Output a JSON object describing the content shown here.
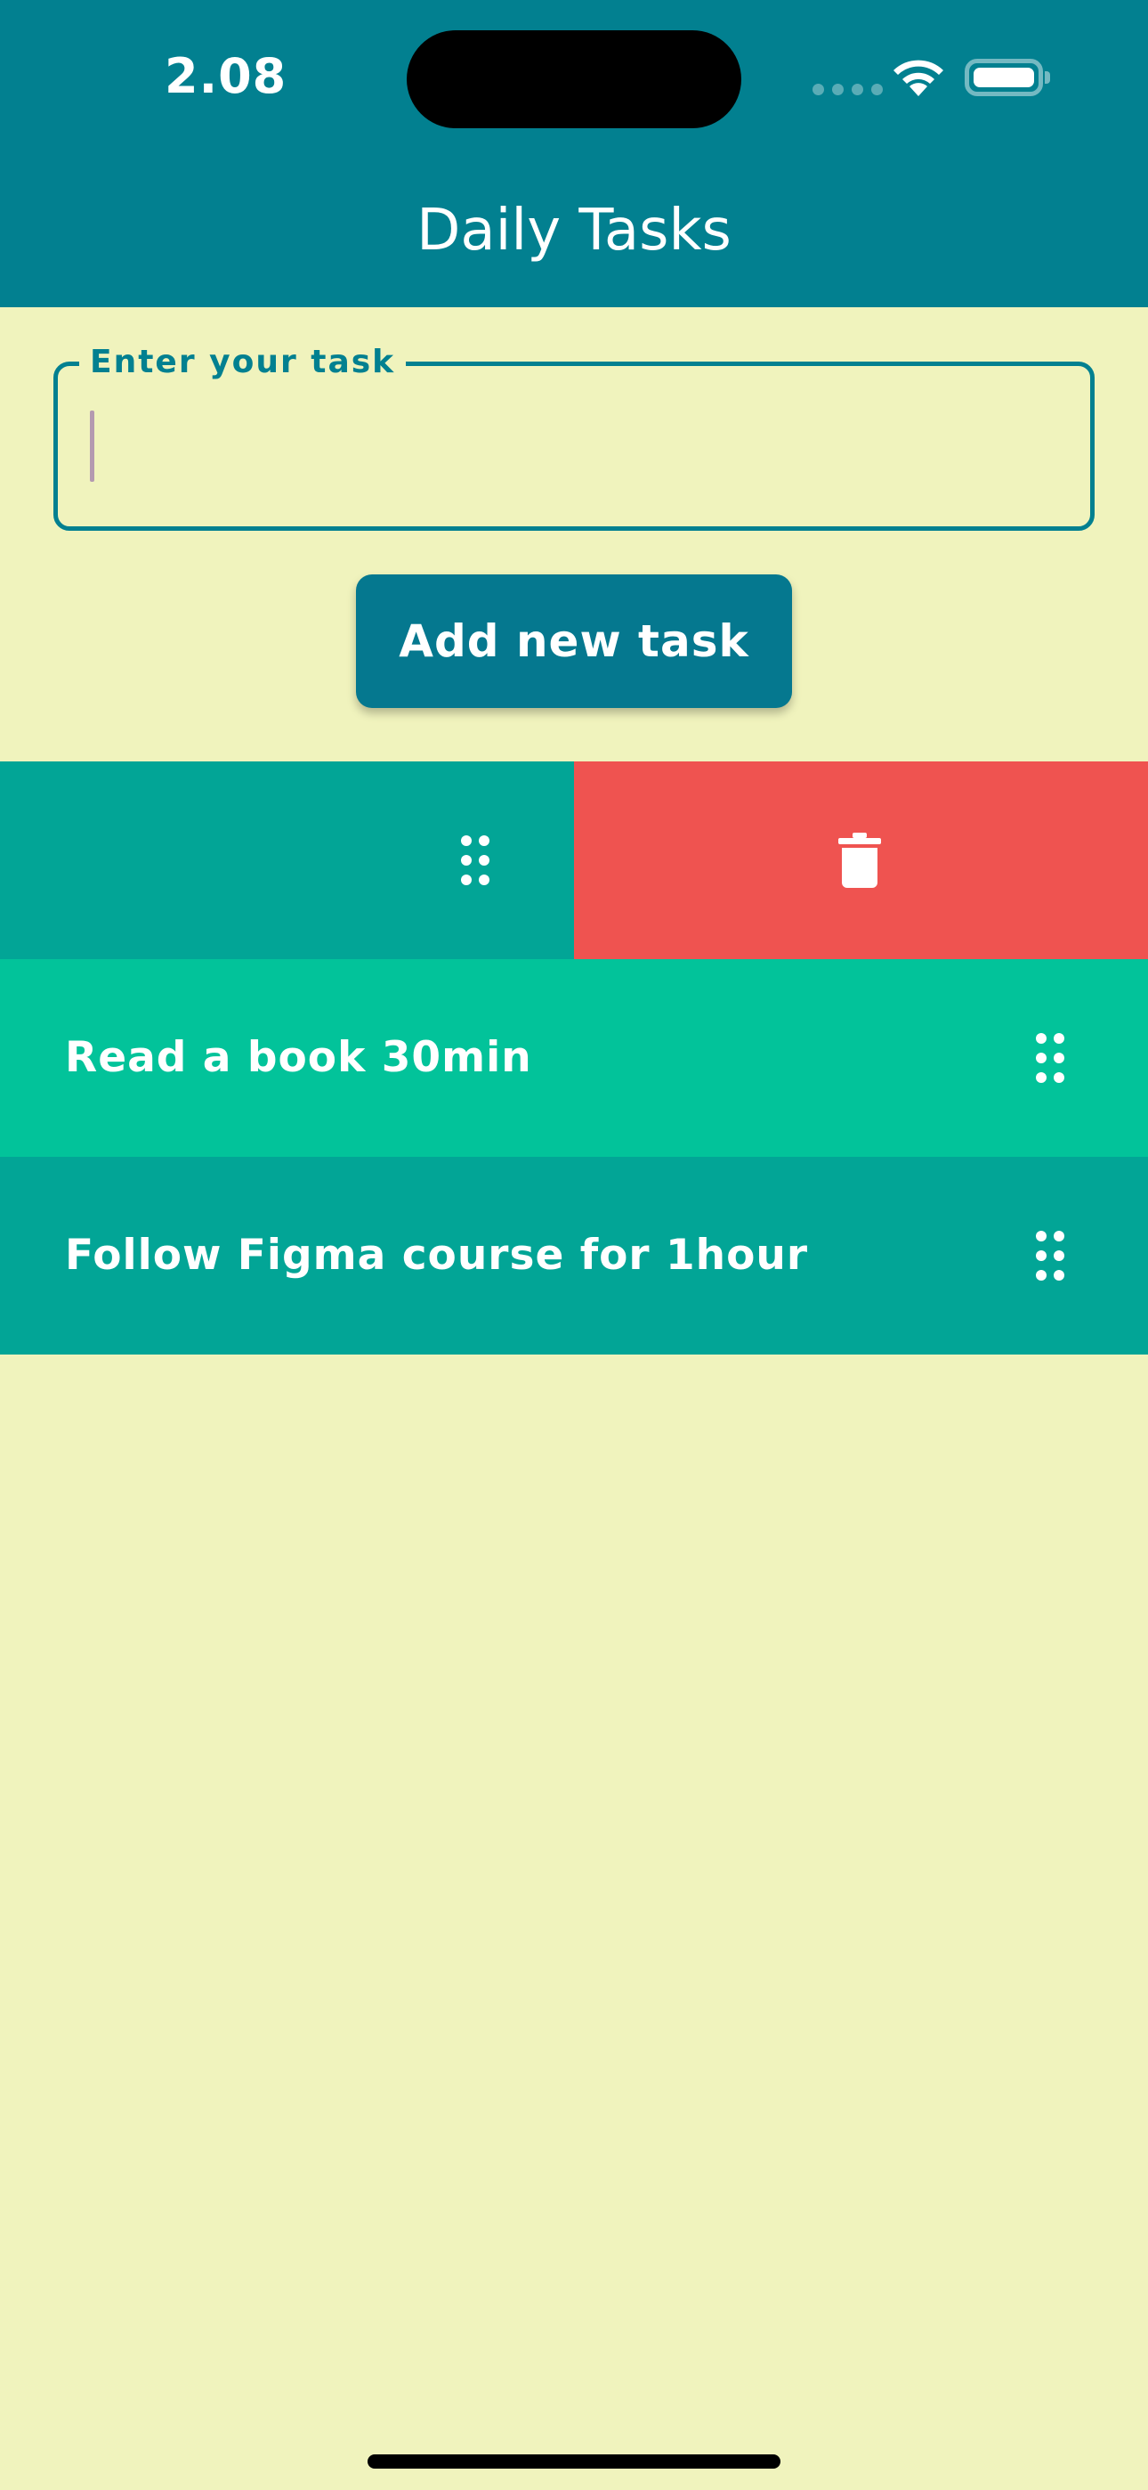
{
  "status_bar": {
    "time": "2.08",
    "icons": [
      "cellular-signal-icon",
      "wifi-icon",
      "battery-icon"
    ]
  },
  "app_bar": {
    "title": "Daily Tasks",
    "color": "#028090"
  },
  "task_input": {
    "label": "Enter your task",
    "value": "",
    "placeholder": ""
  },
  "add_button": {
    "label": "Add new task",
    "color": "#05788f"
  },
  "swiped_row": {
    "delete_icon": "trash-icon",
    "drag_icon": "drag-handle-icon",
    "delete_color": "#ef5350"
  },
  "tasks": [
    {
      "label": "Read a book 30min",
      "color": "#02c39a",
      "icon": "drag-handle-icon"
    },
    {
      "label": "Follow Figma course for 1hour",
      "color": "#02a596",
      "icon": "drag-handle-icon"
    }
  ],
  "colors": {
    "background": "#f0f3bd",
    "primary": "#028090",
    "row_dark": "#02a596",
    "row_light": "#02c39a",
    "danger": "#ef5350"
  }
}
